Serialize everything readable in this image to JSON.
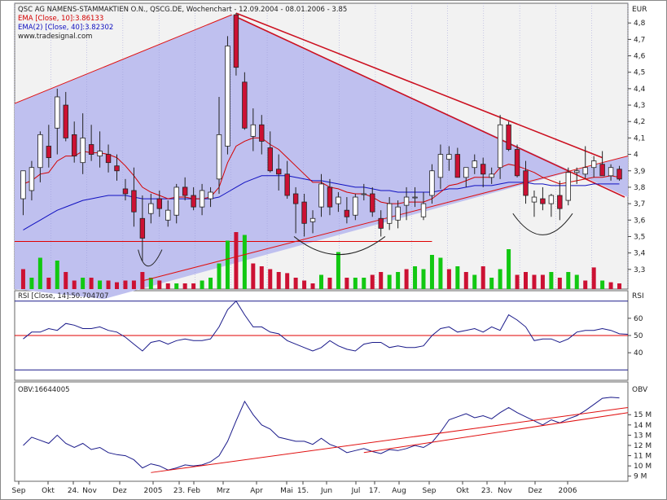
{
  "chart_data": [
    {
      "type": "candlestick",
      "panel": "price",
      "title": "QSC AG NAMENS-STAMMAKTIEN O.N., QSCG.DE, Wochenchart - 12.09.2004 - 08.01.2006 - 3.85",
      "legend": [
        {
          "label": "EMA [Close, 10]:3.86133",
          "color": "#d40000"
        },
        {
          "label": "EMA(2) [Close, 40]:3.82302",
          "color": "#1010c0"
        }
      ],
      "watermark": "www.tradesignal.com",
      "unit_label": "EUR",
      "ylim": [
        3.18,
        4.92
      ],
      "yticks": [
        3.3,
        3.4,
        3.5,
        3.6,
        3.7,
        3.8,
        3.9,
        4,
        4.1,
        4.2,
        4.3,
        4.4,
        4.5,
        4.6,
        4.7,
        4.8
      ],
      "ytick_labels": [
        "3,3",
        "3,4",
        "3,5",
        "3,6",
        "3,7",
        "3,8",
        "3,9",
        "4",
        "4,1",
        "4,2",
        "4,3",
        "4,4",
        "4,5",
        "4,6",
        "4,7",
        "4,8"
      ],
      "x_labels": [
        "Sep",
        "Okt",
        "24.",
        "Nov",
        "Dez",
        "2005",
        "23.",
        "Feb",
        "Mrz",
        "Apr",
        "Mai",
        "15.",
        "Jun",
        "Jul",
        "17.",
        "Aug",
        "Sep",
        "Okt",
        "23.",
        "Nov",
        "Dez",
        "2006"
      ],
      "candles": [
        {
          "o": 3.73,
          "h": 3.88,
          "l": 3.63,
          "c": 3.9
        },
        {
          "o": 3.78,
          "h": 3.96,
          "l": 3.72,
          "c": 3.92
        },
        {
          "o": 3.92,
          "h": 4.14,
          "l": 3.83,
          "c": 4.12
        },
        {
          "o": 4.05,
          "h": 4.18,
          "l": 3.92,
          "c": 3.98
        },
        {
          "o": 4.16,
          "h": 4.4,
          "l": 4.0,
          "c": 4.35
        },
        {
          "o": 4.3,
          "h": 4.38,
          "l": 4.08,
          "c": 4.1
        },
        {
          "o": 4.12,
          "h": 4.2,
          "l": 3.95,
          "c": 3.99
        },
        {
          "o": 3.95,
          "h": 4.25,
          "l": 3.88,
          "c": 4.1
        },
        {
          "o": 4.06,
          "h": 4.18,
          "l": 3.96,
          "c": 4.0
        },
        {
          "o": 3.99,
          "h": 4.14,
          "l": 3.92,
          "c": 4.02
        },
        {
          "o": 4.0,
          "h": 4.06,
          "l": 3.89,
          "c": 3.95
        },
        {
          "o": 3.93,
          "h": 4.0,
          "l": 3.84,
          "c": 3.9
        },
        {
          "o": 3.79,
          "h": 3.85,
          "l": 3.72,
          "c": 3.76
        },
        {
          "o": 3.78,
          "h": 3.92,
          "l": 3.56,
          "c": 3.65
        },
        {
          "o": 3.61,
          "h": 3.75,
          "l": 3.35,
          "c": 3.49
        },
        {
          "o": 3.64,
          "h": 3.76,
          "l": 3.58,
          "c": 3.7
        },
        {
          "o": 3.73,
          "h": 3.78,
          "l": 3.62,
          "c": 3.67
        },
        {
          "o": 3.6,
          "h": 3.72,
          "l": 3.56,
          "c": 3.66
        },
        {
          "o": 3.63,
          "h": 3.82,
          "l": 3.58,
          "c": 3.8
        },
        {
          "o": 3.8,
          "h": 3.86,
          "l": 3.72,
          "c": 3.75
        },
        {
          "o": 3.75,
          "h": 3.8,
          "l": 3.66,
          "c": 3.68
        },
        {
          "o": 3.68,
          "h": 3.82,
          "l": 3.63,
          "c": 3.78
        },
        {
          "o": 3.73,
          "h": 3.8,
          "l": 3.68,
          "c": 3.77
        },
        {
          "o": 3.85,
          "h": 4.35,
          "l": 3.76,
          "c": 4.12
        },
        {
          "o": 4.05,
          "h": 4.72,
          "l": 4.0,
          "c": 4.66
        },
        {
          "o": 4.85,
          "h": 4.86,
          "l": 4.48,
          "c": 4.53
        },
        {
          "o": 4.44,
          "h": 4.5,
          "l": 4.15,
          "c": 4.16
        },
        {
          "o": 4.11,
          "h": 4.28,
          "l": 4.02,
          "c": 4.18
        },
        {
          "o": 4.18,
          "h": 4.24,
          "l": 4.0,
          "c": 4.08
        },
        {
          "o": 4.04,
          "h": 4.14,
          "l": 3.89,
          "c": 3.9
        },
        {
          "o": 3.91,
          "h": 4.0,
          "l": 3.78,
          "c": 3.88
        },
        {
          "o": 3.88,
          "h": 3.96,
          "l": 3.73,
          "c": 3.75
        },
        {
          "o": 3.76,
          "h": 3.8,
          "l": 3.52,
          "c": 3.7
        },
        {
          "o": 3.71,
          "h": 3.76,
          "l": 3.5,
          "c": 3.58
        },
        {
          "o": 3.59,
          "h": 3.66,
          "l": 3.52,
          "c": 3.61
        },
        {
          "o": 3.68,
          "h": 3.88,
          "l": 3.62,
          "c": 3.82
        },
        {
          "o": 3.8,
          "h": 3.85,
          "l": 3.63,
          "c": 3.68
        },
        {
          "o": 3.7,
          "h": 3.77,
          "l": 3.65,
          "c": 3.74
        },
        {
          "o": 3.66,
          "h": 3.74,
          "l": 3.58,
          "c": 3.62
        },
        {
          "o": 3.63,
          "h": 3.76,
          "l": 3.6,
          "c": 3.74
        },
        {
          "o": 3.76,
          "h": 3.82,
          "l": 3.72,
          "c": 3.76
        },
        {
          "o": 3.76,
          "h": 3.8,
          "l": 3.62,
          "c": 3.65
        },
        {
          "o": 3.61,
          "h": 3.66,
          "l": 3.5,
          "c": 3.55
        },
        {
          "o": 3.58,
          "h": 3.74,
          "l": 3.54,
          "c": 3.7
        },
        {
          "o": 3.6,
          "h": 3.72,
          "l": 3.55,
          "c": 3.68
        },
        {
          "o": 3.69,
          "h": 3.8,
          "l": 3.6,
          "c": 3.74
        },
        {
          "o": 3.74,
          "h": 3.8,
          "l": 3.68,
          "c": 3.74
        },
        {
          "o": 3.62,
          "h": 3.77,
          "l": 3.6,
          "c": 3.7
        },
        {
          "o": 3.75,
          "h": 3.94,
          "l": 3.7,
          "c": 3.9
        },
        {
          "o": 3.86,
          "h": 4.06,
          "l": 3.79,
          "c": 4.0
        },
        {
          "o": 3.97,
          "h": 4.05,
          "l": 3.9,
          "c": 4.0
        },
        {
          "o": 4.0,
          "h": 4.04,
          "l": 3.86,
          "c": 3.86
        },
        {
          "o": 3.86,
          "h": 3.92,
          "l": 3.8,
          "c": 3.92
        },
        {
          "o": 3.92,
          "h": 4.0,
          "l": 3.88,
          "c": 3.96
        },
        {
          "o": 3.94,
          "h": 3.98,
          "l": 3.8,
          "c": 3.88
        },
        {
          "o": 3.86,
          "h": 3.92,
          "l": 3.82,
          "c": 3.88
        },
        {
          "o": 3.92,
          "h": 4.24,
          "l": 3.85,
          "c": 4.18
        },
        {
          "o": 4.18,
          "h": 4.2,
          "l": 4.02,
          "c": 4.03
        },
        {
          "o": 4.03,
          "h": 4.06,
          "l": 3.86,
          "c": 3.87
        },
        {
          "o": 3.9,
          "h": 3.96,
          "l": 3.7,
          "c": 3.75
        },
        {
          "o": 3.71,
          "h": 3.78,
          "l": 3.62,
          "c": 3.74
        },
        {
          "o": 3.73,
          "h": 3.8,
          "l": 3.66,
          "c": 3.7
        },
        {
          "o": 3.7,
          "h": 3.76,
          "l": 3.62,
          "c": 3.75
        },
        {
          "o": 3.75,
          "h": 3.84,
          "l": 3.6,
          "c": 3.67
        },
        {
          "o": 3.72,
          "h": 3.92,
          "l": 3.69,
          "c": 3.89
        },
        {
          "o": 3.89,
          "h": 3.92,
          "l": 3.82,
          "c": 3.9
        },
        {
          "o": 3.88,
          "h": 4.05,
          "l": 3.85,
          "c": 3.92
        },
        {
          "o": 3.92,
          "h": 3.99,
          "l": 3.86,
          "c": 3.96
        },
        {
          "o": 3.94,
          "h": 4.02,
          "l": 3.9,
          "c": 3.87
        },
        {
          "o": 3.87,
          "h": 3.94,
          "l": 3.84,
          "c": 3.92
        },
        {
          "o": 3.91,
          "h": 3.93,
          "l": 3.84,
          "c": 3.85
        }
      ],
      "ema10": [
        3.82,
        3.84,
        3.88,
        3.89,
        3.96,
        3.99,
        3.99,
        4.02,
        4.01,
        4.01,
        4.0,
        3.98,
        3.93,
        3.87,
        3.8,
        3.77,
        3.75,
        3.73,
        3.74,
        3.74,
        3.73,
        3.73,
        3.74,
        3.8,
        3.95,
        4.05,
        4.08,
        4.1,
        4.1,
        4.06,
        4.03,
        3.98,
        3.93,
        3.88,
        3.83,
        3.83,
        3.8,
        3.79,
        3.77,
        3.76,
        3.76,
        3.74,
        3.71,
        3.7,
        3.7,
        3.71,
        3.71,
        3.71,
        3.73,
        3.77,
        3.81,
        3.82,
        3.84,
        3.86,
        3.86,
        3.86,
        3.92,
        3.94,
        3.93,
        3.91,
        3.89,
        3.86,
        3.84,
        3.82,
        3.83,
        3.84,
        3.85,
        3.86,
        3.86,
        3.87,
        3.86
      ],
      "ema40": [
        3.54,
        3.57,
        3.6,
        3.63,
        3.66,
        3.68,
        3.7,
        3.72,
        3.73,
        3.74,
        3.75,
        3.75,
        3.75,
        3.74,
        3.73,
        3.73,
        3.73,
        3.73,
        3.73,
        3.73,
        3.73,
        3.73,
        3.73,
        3.74,
        3.77,
        3.8,
        3.83,
        3.85,
        3.87,
        3.87,
        3.87,
        3.87,
        3.86,
        3.85,
        3.84,
        3.84,
        3.83,
        3.82,
        3.81,
        3.8,
        3.8,
        3.79,
        3.78,
        3.78,
        3.77,
        3.77,
        3.77,
        3.77,
        3.77,
        3.78,
        3.79,
        3.79,
        3.8,
        3.81,
        3.81,
        3.81,
        3.82,
        3.83,
        3.83,
        3.83,
        3.82,
        3.82,
        3.81,
        3.81,
        3.81,
        3.81,
        3.81,
        3.82,
        3.82,
        3.82,
        3.82
      ],
      "channel_upper": [
        [
          3.2,
          4.31
        ],
        [
          4.85,
          4.85
        ]
      ],
      "channel_lower": [
        [
          2.98,
          3.5
        ],
        [
          4.15,
          3.93
        ]
      ],
      "trendline_1": [
        [
          4.85,
          4.85
        ],
        [
          3.98,
          3.98
        ]
      ],
      "trendline_2": [
        [
          4.82,
          4.82
        ],
        [
          3.75,
          3.75
        ]
      ],
      "support_line": 3.47,
      "volume": [
        {
          "v": 0.35,
          "up": false
        },
        {
          "v": 0.2,
          "up": true
        },
        {
          "v": 0.55,
          "up": true
        },
        {
          "v": 0.2,
          "up": false
        },
        {
          "v": 0.5,
          "up": true
        },
        {
          "v": 0.3,
          "up": false
        },
        {
          "v": 0.15,
          "up": false
        },
        {
          "v": 0.2,
          "up": true
        },
        {
          "v": 0.2,
          "up": false
        },
        {
          "v": 0.15,
          "up": true
        },
        {
          "v": 0.15,
          "up": false
        },
        {
          "v": 0.12,
          "up": false
        },
        {
          "v": 0.15,
          "up": false
        },
        {
          "v": 0.15,
          "up": false
        },
        {
          "v": 0.3,
          "up": false
        },
        {
          "v": 0.2,
          "up": true
        },
        {
          "v": 0.15,
          "up": false
        },
        {
          "v": 0.1,
          "up": false
        },
        {
          "v": 0.1,
          "up": true
        },
        {
          "v": 0.1,
          "up": false
        },
        {
          "v": 0.1,
          "up": false
        },
        {
          "v": 0.15,
          "up": true
        },
        {
          "v": 0.2,
          "up": true
        },
        {
          "v": 0.45,
          "up": true
        },
        {
          "v": 0.85,
          "up": true
        },
        {
          "v": 1.0,
          "up": false
        },
        {
          "v": 0.95,
          "up": true
        },
        {
          "v": 0.45,
          "up": false
        },
        {
          "v": 0.4,
          "up": false
        },
        {
          "v": 0.35,
          "up": false
        },
        {
          "v": 0.3,
          "up": false
        },
        {
          "v": 0.28,
          "up": false
        },
        {
          "v": 0.2,
          "up": false
        },
        {
          "v": 0.15,
          "up": false
        },
        {
          "v": 0.1,
          "up": false
        },
        {
          "v": 0.25,
          "up": true
        },
        {
          "v": 0.2,
          "up": false
        },
        {
          "v": 0.65,
          "up": true
        },
        {
          "v": 0.2,
          "up": false
        },
        {
          "v": 0.2,
          "up": true
        },
        {
          "v": 0.2,
          "up": true
        },
        {
          "v": 0.25,
          "up": false
        },
        {
          "v": 0.3,
          "up": false
        },
        {
          "v": 0.25,
          "up": true
        },
        {
          "v": 0.3,
          "up": true
        },
        {
          "v": 0.35,
          "up": false
        },
        {
          "v": 0.4,
          "up": true
        },
        {
          "v": 0.35,
          "up": true
        },
        {
          "v": 0.6,
          "up": true
        },
        {
          "v": 0.55,
          "up": true
        },
        {
          "v": 0.35,
          "up": false
        },
        {
          "v": 0.4,
          "up": true
        },
        {
          "v": 0.3,
          "up": false
        },
        {
          "v": 0.25,
          "up": true
        },
        {
          "v": 0.4,
          "up": false
        },
        {
          "v": 0.2,
          "up": true
        },
        {
          "v": 0.35,
          "up": true
        },
        {
          "v": 0.7,
          "up": true
        },
        {
          "v": 0.25,
          "up": false
        },
        {
          "v": 0.3,
          "up": false
        },
        {
          "v": 0.25,
          "up": false
        },
        {
          "v": 0.25,
          "up": false
        },
        {
          "v": 0.3,
          "up": true
        },
        {
          "v": 0.2,
          "up": false
        },
        {
          "v": 0.3,
          "up": true
        },
        {
          "v": 0.25,
          "up": true
        },
        {
          "v": 0.15,
          "up": false
        },
        {
          "v": 0.38,
          "up": false
        },
        {
          "v": 0.15,
          "up": true
        },
        {
          "v": 0.12,
          "up": false
        },
        {
          "v": 0.1,
          "up": false
        }
      ]
    },
    {
      "type": "line",
      "panel": "rsi",
      "legend": "RSI [Close, 14]:50.704707",
      "unit_label": "RSI",
      "ylim": [
        24,
        76
      ],
      "yticks": [
        40,
        50,
        60
      ],
      "ytick_labels": [
        "40",
        "50",
        "60"
      ],
      "levels": [
        30,
        50,
        70
      ],
      "values": [
        48,
        52,
        52,
        54,
        53,
        57,
        56,
        54,
        54,
        55,
        53,
        52,
        49,
        45,
        41,
        46,
        47,
        45,
        47,
        48,
        47,
        47,
        48,
        55,
        65,
        70,
        62,
        55,
        55,
        52,
        51,
        47,
        45,
        43,
        41,
        43,
        47,
        44,
        42,
        41,
        45,
        46,
        46,
        43,
        44,
        43,
        43,
        44,
        50,
        54,
        55,
        52,
        53,
        54,
        52,
        55,
        53,
        62,
        59,
        55,
        47,
        48,
        48,
        46,
        48,
        52,
        53,
        53,
        54,
        53,
        51,
        50.7
      ]
    },
    {
      "type": "line",
      "panel": "obv",
      "legend": "OBV:16644005",
      "unit_label": "OBV",
      "ylim": [
        8.5,
        18.2
      ],
      "yticks": [
        9,
        10,
        11,
        12,
        13,
        14,
        15
      ],
      "ytick_labels": [
        "9 M",
        "10 M",
        "11 M",
        "12 M",
        "13 M",
        "14 M",
        "15 M"
      ],
      "values": [
        12.0,
        12.8,
        12.5,
        12.2,
        13.0,
        12.2,
        11.8,
        12.2,
        11.6,
        11.8,
        11.3,
        11.1,
        11.0,
        10.6,
        9.8,
        10.2,
        10.0,
        9.6,
        9.8,
        10.1,
        10.0,
        10.1,
        10.4,
        11.0,
        12.4,
        14.4,
        16.3,
        15.0,
        14.0,
        13.6,
        12.8,
        12.6,
        12.4,
        12.4,
        12.1,
        12.7,
        12.1,
        11.8,
        11.3,
        11.5,
        11.7,
        11.4,
        11.2,
        11.6,
        11.5,
        11.7,
        12.0,
        11.8,
        12.3,
        13.3,
        14.5,
        14.8,
        15.1,
        14.7,
        14.9,
        14.6,
        15.2,
        15.7,
        15.2,
        14.8,
        14.4,
        14.0,
        14.5,
        14.2,
        14.6,
        14.9,
        15.4,
        16.0,
        16.6,
        16.7,
        16.64
      ],
      "trendline_1": [
        [
          9.3,
          9.3
        ],
        [
          15.7,
          15.7
        ]
      ],
      "trendline_2": [
        [
          11.2,
          11.2
        ],
        [
          15.2,
          15.2
        ]
      ]
    }
  ]
}
